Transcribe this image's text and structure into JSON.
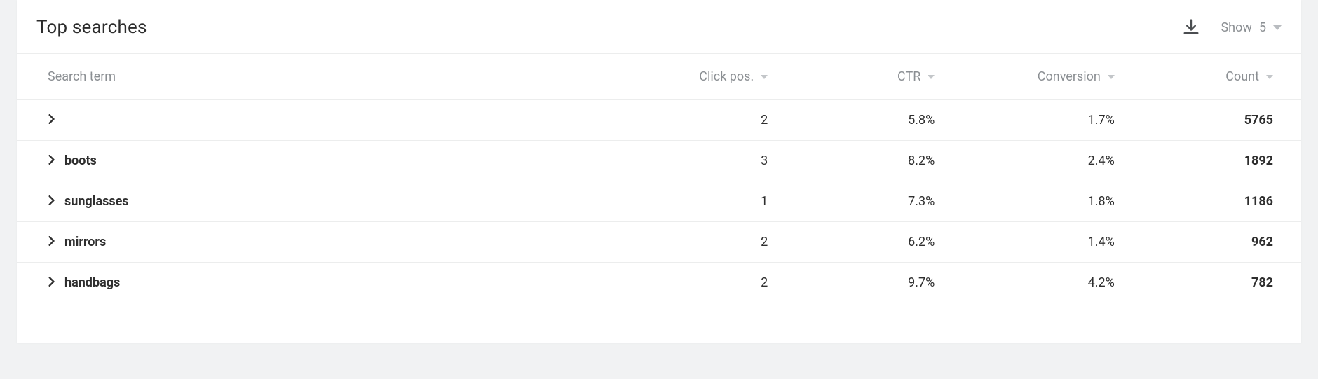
{
  "header": {
    "title": "Top searches",
    "show_label": "Show",
    "show_value": "5"
  },
  "columns": {
    "term": "Search term",
    "click_pos": "Click pos.",
    "ctr": "CTR",
    "conversion": "Conversion",
    "count": "Count"
  },
  "rows": [
    {
      "term": "",
      "click_pos": "2",
      "ctr": "5.8%",
      "conversion": "1.7%",
      "count": "5765"
    },
    {
      "term": "boots",
      "click_pos": "3",
      "ctr": "8.2%",
      "conversion": "2.4%",
      "count": "1892"
    },
    {
      "term": "sunglasses",
      "click_pos": "1",
      "ctr": "7.3%",
      "conversion": "1.8%",
      "count": "1186"
    },
    {
      "term": "mirrors",
      "click_pos": "2",
      "ctr": "6.2%",
      "conversion": "1.4%",
      "count": "962"
    },
    {
      "term": "handbags",
      "click_pos": "2",
      "ctr": "9.7%",
      "conversion": "4.2%",
      "count": "782"
    }
  ]
}
